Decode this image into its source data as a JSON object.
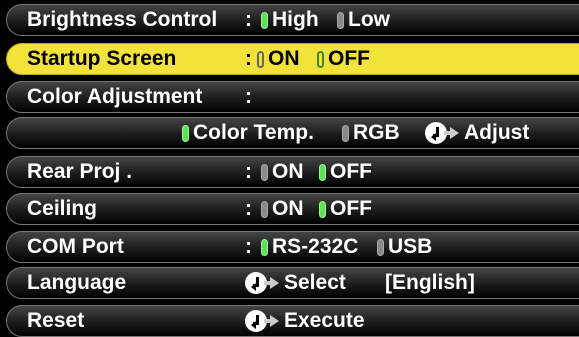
{
  "rows": {
    "brightness": {
      "label": "Brightness Control",
      "colon": ":",
      "opt1": "High",
      "opt2": "Low"
    },
    "startup": {
      "label": "Startup Screen",
      "colon": ":",
      "opt1": "ON",
      "opt2": "OFF"
    },
    "color_adjustment": {
      "label": "Color Adjustment",
      "colon": ":"
    },
    "color_sub": {
      "opt1": "Color Temp.",
      "opt2": "RGB",
      "action": "Adjust"
    },
    "rear_proj": {
      "label": "Rear Proj .",
      "colon": ":",
      "opt1": "ON",
      "opt2": "OFF"
    },
    "ceiling": {
      "label": "Ceiling",
      "colon": ":",
      "opt1": "ON",
      "opt2": "OFF"
    },
    "com_port": {
      "label": "COM Port",
      "colon": ":",
      "opt1": "RS-232C",
      "opt2": "USB"
    },
    "language": {
      "label": "Language",
      "action": "Select",
      "value": "[English]"
    },
    "reset": {
      "label": "Reset",
      "action": "Execute"
    }
  },
  "colors": {
    "selected_bg": "#f2e23a",
    "indicator_on": "#5fe05a",
    "indicator_off": "#8a8a8a"
  }
}
